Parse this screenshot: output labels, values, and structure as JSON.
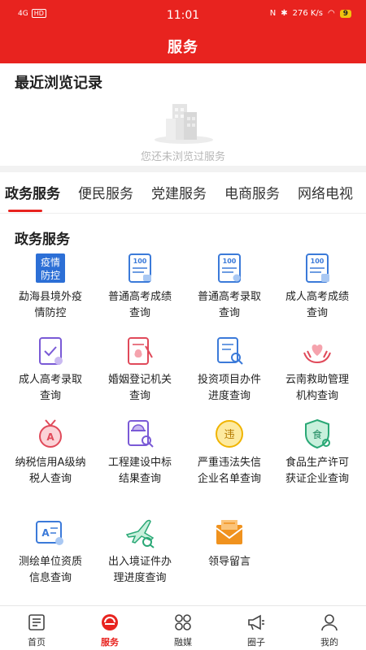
{
  "status_bar": {
    "network": "4G",
    "hd": "HD",
    "time": "11:01",
    "speed": "276 K/s",
    "battery": "9"
  },
  "header": {
    "title": "服务"
  },
  "recent": {
    "title": "最近浏览记录",
    "empty_text": "您还未浏览过服务"
  },
  "tabs": [
    {
      "label": "政务服务",
      "active": true
    },
    {
      "label": "便民服务",
      "active": false
    },
    {
      "label": "党建服务",
      "active": false
    },
    {
      "label": "电商服务",
      "active": false
    },
    {
      "label": "网络电视",
      "active": false
    }
  ],
  "section": {
    "title": "政务服务",
    "items": [
      {
        "label": "勐海县境外疫情防控",
        "icon": "epidemic-control-icon",
        "icon_text": "疫情防控"
      },
      {
        "label": "普通高考成绩查询",
        "icon": "exam-score-icon",
        "icon_text": "100"
      },
      {
        "label": "普通高考录取查询",
        "icon": "exam-admission-icon",
        "icon_text": "100"
      },
      {
        "label": "成人高考成绩查询",
        "icon": "adult-exam-score-icon",
        "icon_text": "100"
      },
      {
        "label": "成人高考录取查询",
        "icon": "adult-exam-admission-icon"
      },
      {
        "label": "婚姻登记机关查询",
        "icon": "marriage-registration-icon"
      },
      {
        "label": "投资项目办件进度查询",
        "icon": "investment-project-icon"
      },
      {
        "label": "云南救助管理机构查询",
        "icon": "rescue-agency-icon"
      },
      {
        "label": "纳税信用A级纳税人查询",
        "icon": "tax-credit-icon",
        "icon_text": "A"
      },
      {
        "label": "工程建设中标结果查询",
        "icon": "construction-bid-icon"
      },
      {
        "label": "严重违法失信企业名单查询",
        "icon": "violation-list-icon",
        "icon_text": "违"
      },
      {
        "label": "食品生产许可获证企业查询",
        "icon": "food-license-icon",
        "icon_text": "食"
      },
      {
        "label": "测绘单位资质信息查询",
        "icon": "surveying-unit-icon"
      },
      {
        "label": "出入境证件办理进度查询",
        "icon": "immigration-document-icon"
      },
      {
        "label": "领导留言",
        "icon": "leader-message-icon"
      }
    ]
  },
  "bottom_nav": [
    {
      "label": "首页",
      "icon": "home-newspaper-icon",
      "active": false
    },
    {
      "label": "服务",
      "icon": "service-icon",
      "active": true
    },
    {
      "label": "融媒",
      "icon": "media-grid-icon",
      "active": false
    },
    {
      "label": "圈子",
      "icon": "megaphone-icon",
      "active": false
    },
    {
      "label": "我的",
      "icon": "user-icon",
      "active": false
    }
  ],
  "colors": {
    "brand_red": "#e8231f",
    "icon_blue": "#3b7ad9",
    "icon_pink": "#e04a5a",
    "icon_green": "#2aa876",
    "icon_orange": "#f0921e",
    "icon_yellow": "#f3c51d",
    "icon_purple": "#7a5ad6"
  }
}
